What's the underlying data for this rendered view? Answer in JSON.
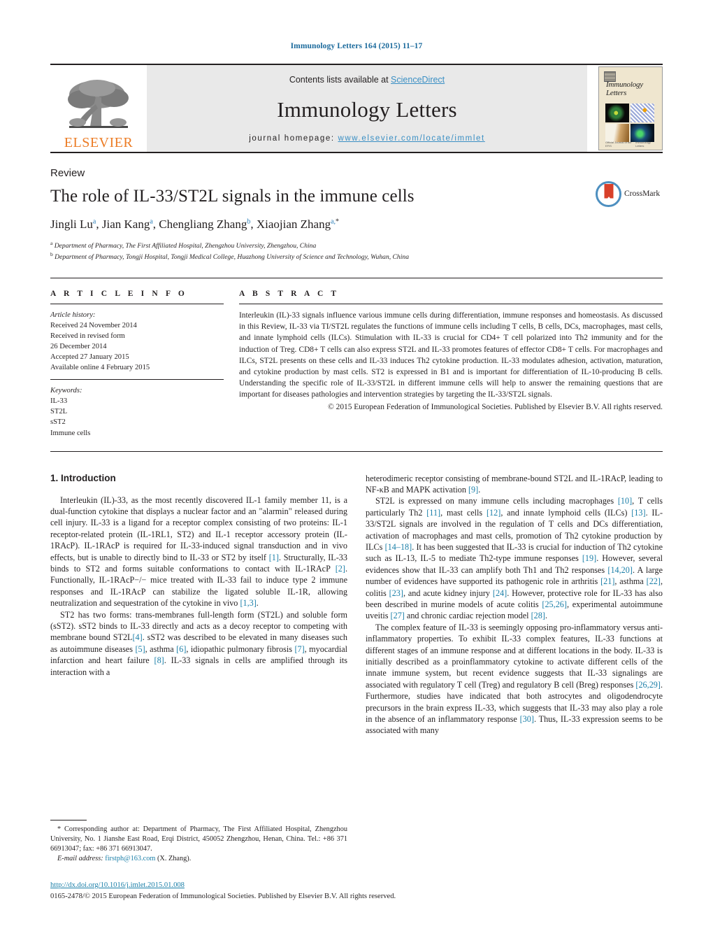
{
  "running_head": "Immunology Letters 164 (2015) 11–17",
  "masthead": {
    "publisher_name": "ELSEVIER",
    "contents_prefix": "Contents lists available at ",
    "contents_link": "ScienceDirect",
    "journal_title": "Immunology Letters",
    "homepage_prefix": "journal homepage: ",
    "homepage_url": "www.elsevier.com/locate/immlet",
    "cover_title": "Immunology Letters",
    "cover_foot_left": "Official Journal of the EFIS",
    "cover_foot_right": "Immunology Letters"
  },
  "article": {
    "doctype": "Review",
    "title": "The role of IL-33/ST2L signals in the immune cells",
    "authors_html": "Jingli Lu<sup>a</sup>, Jian Kang<sup>a</sup>, Chengliang Zhang<sup>b</sup>, Xiaojian Zhang<sup>a,</sup><sup class=\"star\">*</sup>",
    "affiliation_a": "Department of Pharmacy, The First Affiliated Hospital, Zhengzhou University, Zhengzhou, China",
    "affiliation_b": "Department of Pharmacy, Tongji Hospital, Tongji Medical College, Huazhong University of Science and Technology, Wuhan, China",
    "crossmark_label": "CrossMark"
  },
  "article_info": {
    "heading": "A R T I C L E  I N F O",
    "history_label": "Article history:",
    "history": [
      "Received 24 November 2014",
      "Received in revised form",
      "26 December 2014",
      "Accepted 27 January 2015",
      "Available online 4 February 2015"
    ],
    "keywords_label": "Keywords:",
    "keywords": [
      "IL-33",
      "ST2L",
      "sST2",
      "Immune cells"
    ]
  },
  "abstract": {
    "heading": "A B S T R A C T",
    "text": "Interleukin (IL)-33 signals influence various immune cells during differentiation, immune responses and homeostasis. As discussed in this Review, IL-33 via TI/ST2L regulates the functions of immune cells including T cells, B cells, DCs, macrophages, mast cells, and innate lymphoid cells (ILCs). Stimulation with IL-33 is crucial for CD4+ T cell polarized into Th2 immunity and for the induction of Treg. CD8+ T cells can also express ST2L and IL-33 promotes features of effector CD8+ T cells. For macrophages and ILCs, ST2L presents on these cells and IL-33 induces Th2 cytokine production. IL-33 modulates adhesion, activation, maturation, and cytokine production by mast cells. ST2 is expressed in B1 and is important for differentiation of IL-10-producing B cells. Understanding the specific role of IL-33/ST2L in different immune cells will help to answer the remaining questions that are important for diseases pathologies and intervention strategies by targeting the IL-33/ST2L signals.",
    "copyright": "© 2015 European Federation of Immunological Societies. Published by Elsevier B.V. All rights reserved."
  },
  "body": {
    "section_heading": "1.  Introduction",
    "left_paragraphs": [
      "Interleukin (IL)-33, as the most recently discovered IL-1 family member 11, is a dual-function cytokine that displays a nuclear factor and an \"alarmin\" released during cell injury. IL-33 is a ligand for a receptor complex consisting of two proteins: IL-1 receptor-related protein (IL-1RL1, ST2) and IL-1 receptor accessory protein (IL-1RAcP). IL-1RAcP is required for IL-33-induced signal transduction and in vivo effects, but is unable to directly bind to IL-33 or ST2 by itself [1]. Structurally, IL-33 binds to ST2 and forms suitable conformations to contact with IL-1RAcP [2]. Functionally, IL-1RAcP−/− mice treated with IL-33 fail to induce type 2 immune responses and IL-1RAcP can stabilize the ligated soluble IL-1R, allowing neutralization and sequestration of the cytokine in vivo [1,3].",
      "ST2 has two forms: trans-membranes full-length form (ST2L) and soluble form (sST2). sST2 binds to IL-33 directly and acts as a decoy receptor to competing with membrane bound ST2L[4]. sST2 was described to be elevated in many diseases such as autoimmune diseases [5], asthma [6], idiopathic pulmonary fibrosis [7], myocardial infarction and heart failure [8]. IL-33 signals in cells are amplified through its interaction with a"
    ],
    "right_paragraphs": [
      "heterodimeric receptor consisting of membrane-bound ST2L and IL-1RAcP, leading to NF-κB and MAPK activation [9].",
      "ST2L is expressed on many immune cells including macrophages [10], T cells particularly Th2 [11], mast cells [12], and innate lymphoid cells (ILCs) [13]. IL-33/ST2L signals are involved in the regulation of T cells and DCs differentiation, activation of macrophages and mast cells, promotion of Th2 cytokine production by ILCs [14–18]. It has been suggested that IL-33 is crucial for induction of Th2 cytokine such as IL-13, IL-5 to mediate Th2-type immune responses [19]. However, several evidences show that IL-33 can amplify both Th1 and Th2 responses [14,20]. A large number of evidences have supported its pathogenic role in arthritis [21], asthma [22], colitis [23], and acute kidney injury [24]. However, protective role for IL-33 has also been described in murine models of acute colitis [25,26], experimental autoimmune uveitis [27] and chronic cardiac rejection model [28].",
      "The complex feature of IL-33 is seemingly opposing pro-inflammatory versus anti-inflammatory properties. To exhibit IL-33 complex features, IL-33 functions at different stages of an immune response and at different locations in the body. IL-33 is initially described as a proinflammatory cytokine to activate different cells of the innate immune system, but recent evidence suggests that IL-33 signalings are associated with regulatory T cell (Treg) and regulatory B cell (Breg) responses [26,29]. Furthermore, studies have indicated that both astrocytes and oligodendrocyte precursors in the brain express IL-33, which suggests that IL-33 may also play a role in the absence of an inflammatory response [30]. Thus, IL-33 expression seems to be associated with many"
    ]
  },
  "footnotes": {
    "corresponding": "* Corresponding author at: Department of Pharmacy, The First Affiliated Hospital, Zhengzhou University, No. 1 Jianshe East Road, Erqi District, 450052 Zhengzhou, Henan, China. Tel.: +86 371 66913047; fax: +86 371 66913047.",
    "email_label": "E-mail address:",
    "email": "firstph@163.com",
    "email_suffix": " (X. Zhang)."
  },
  "bottom": {
    "doi": "http://dx.doi.org/10.1016/j.imlet.2015.01.008",
    "issn_line": "0165-2478/© 2015 European Federation of Immunological Societies. Published by Elsevier B.V. All rights reserved."
  },
  "colors": {
    "link": "#1b7fa8",
    "elsevier_orange": "#ec7c25",
    "masthead_grey": "#e9e9e9",
    "crossmark_blue": "#4d8fc0",
    "crossmark_red": "#d8402a"
  }
}
